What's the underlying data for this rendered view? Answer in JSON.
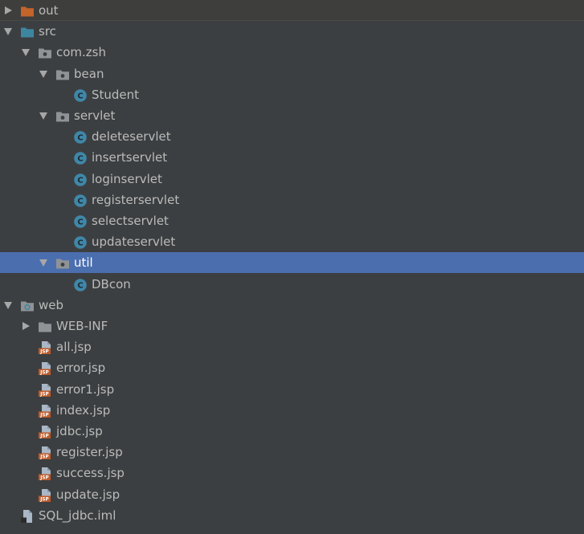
{
  "colors": {
    "background": "#3c3f41",
    "selection": "#4b6eaf",
    "text": "#bbbbbb",
    "folder_plain": "#8f9396",
    "folder_excluded": "#c3642a",
    "folder_source": "#3e86a0",
    "class_icon": "#3f87a8",
    "jsp_icon": "#c05a27"
  },
  "tree": [
    {
      "label": "out",
      "depth": 0,
      "expandable": true,
      "expanded": false,
      "icon": "excluded-folder-icon"
    },
    {
      "label": "src",
      "depth": 0,
      "expandable": true,
      "expanded": true,
      "icon": "source-folder-icon"
    },
    {
      "label": "com.zsh",
      "depth": 1,
      "expandable": true,
      "expanded": true,
      "icon": "package-icon"
    },
    {
      "label": "bean",
      "depth": 2,
      "expandable": true,
      "expanded": true,
      "icon": "package-icon"
    },
    {
      "label": "Student",
      "depth": 3,
      "expandable": false,
      "icon": "class-icon"
    },
    {
      "label": "servlet",
      "depth": 2,
      "expandable": true,
      "expanded": true,
      "icon": "package-icon"
    },
    {
      "label": "deleteservlet",
      "depth": 3,
      "expandable": false,
      "icon": "class-icon"
    },
    {
      "label": "insertservlet",
      "depth": 3,
      "expandable": false,
      "icon": "class-icon"
    },
    {
      "label": "loginservlet",
      "depth": 3,
      "expandable": false,
      "icon": "class-icon"
    },
    {
      "label": "registerservlet",
      "depth": 3,
      "expandable": false,
      "icon": "class-icon"
    },
    {
      "label": "selectservlet",
      "depth": 3,
      "expandable": false,
      "icon": "class-icon"
    },
    {
      "label": "updateservlet",
      "depth": 3,
      "expandable": false,
      "icon": "class-icon"
    },
    {
      "label": "util",
      "depth": 2,
      "expandable": true,
      "expanded": true,
      "selected": true,
      "icon": "package-icon"
    },
    {
      "label": "DBcon",
      "depth": 3,
      "expandable": false,
      "icon": "class-icon"
    },
    {
      "label": "web",
      "depth": 0,
      "expandable": true,
      "expanded": true,
      "icon": "web-folder-icon"
    },
    {
      "label": "WEB-INF",
      "depth": 1,
      "expandable": true,
      "expanded": false,
      "icon": "folder-icon"
    },
    {
      "label": "all.jsp",
      "depth": 1,
      "expandable": false,
      "icon": "jsp-file-icon"
    },
    {
      "label": "error.jsp",
      "depth": 1,
      "expandable": false,
      "icon": "jsp-file-icon"
    },
    {
      "label": "error1.jsp",
      "depth": 1,
      "expandable": false,
      "icon": "jsp-file-icon"
    },
    {
      "label": "index.jsp",
      "depth": 1,
      "expandable": false,
      "icon": "jsp-file-icon"
    },
    {
      "label": "jdbc.jsp",
      "depth": 1,
      "expandable": false,
      "icon": "jsp-file-icon"
    },
    {
      "label": "register.jsp",
      "depth": 1,
      "expandable": false,
      "icon": "jsp-file-icon"
    },
    {
      "label": "success.jsp",
      "depth": 1,
      "expandable": false,
      "icon": "jsp-file-icon"
    },
    {
      "label": "update.jsp",
      "depth": 1,
      "expandable": false,
      "icon": "jsp-file-icon"
    },
    {
      "label": "SQL_jdbc.iml",
      "depth": 0,
      "expandable": false,
      "icon": "iml-file-icon"
    }
  ]
}
